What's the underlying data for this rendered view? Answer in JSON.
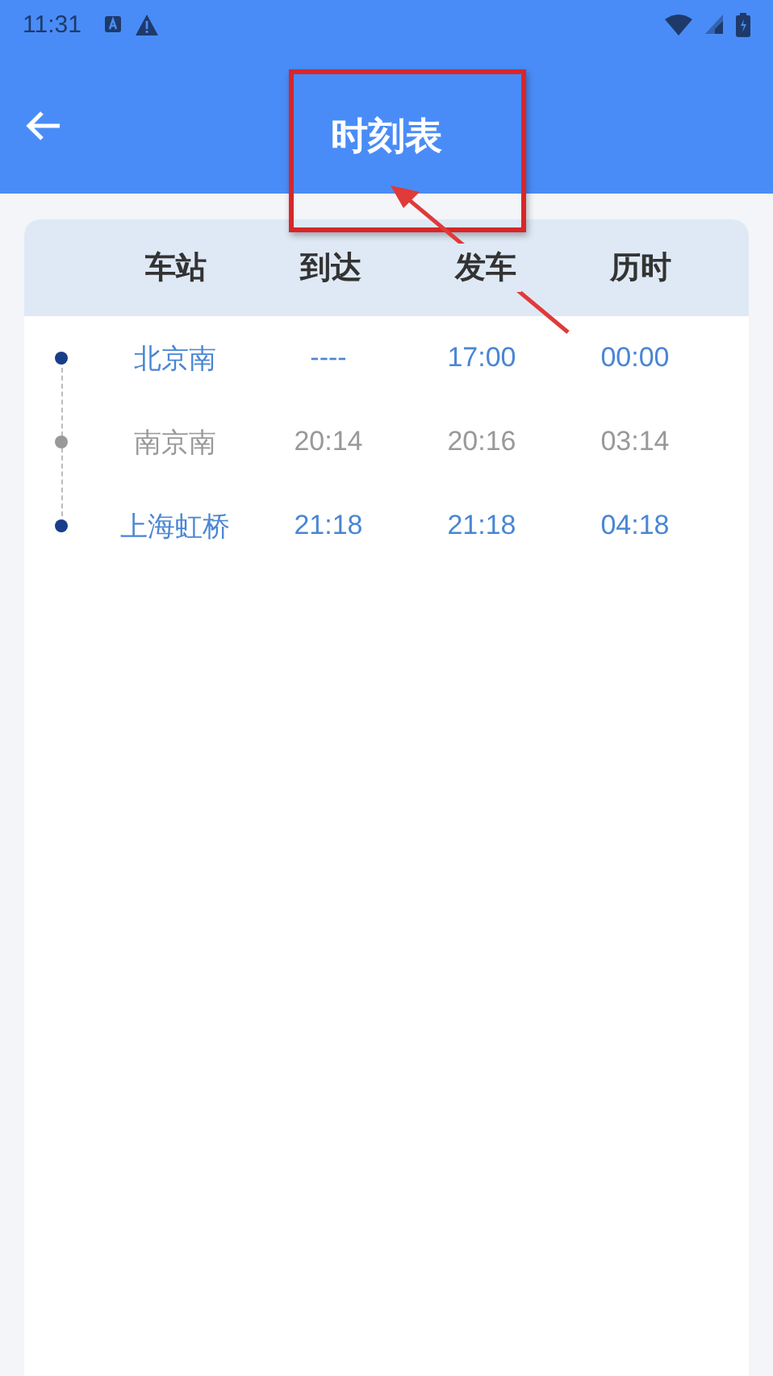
{
  "status_bar": {
    "time": "11:31"
  },
  "app_bar": {
    "title": "时刻表"
  },
  "table": {
    "columns": [
      "车站",
      "到达",
      "发车",
      "历时"
    ],
    "rows": [
      {
        "kind": "terminal",
        "station": "北京南",
        "arrive": "----",
        "depart": "17:00",
        "duration": "00:00"
      },
      {
        "kind": "intermediate",
        "station": "南京南",
        "arrive": "20:14",
        "depart": "20:16",
        "duration": "03:14"
      },
      {
        "kind": "terminal",
        "station": "上海虹桥",
        "arrive": "21:18",
        "depart": "21:18",
        "duration": "04:18"
      }
    ]
  }
}
